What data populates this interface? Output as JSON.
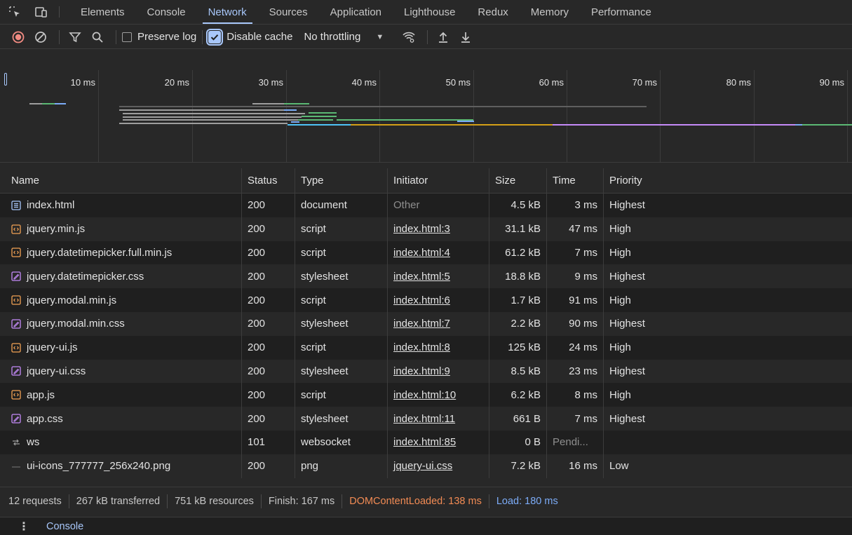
{
  "tabs": [
    {
      "label": "Elements"
    },
    {
      "label": "Console"
    },
    {
      "label": "Network"
    },
    {
      "label": "Sources"
    },
    {
      "label": "Application"
    },
    {
      "label": "Lighthouse"
    },
    {
      "label": "Redux"
    },
    {
      "label": "Memory"
    },
    {
      "label": "Performance"
    }
  ],
  "active_tab": "Network",
  "toolbar": {
    "preserve_log_label": "Preserve log",
    "disable_cache_label": "Disable cache",
    "throttling_value": "No throttling"
  },
  "overview": {
    "tick_labels": [
      "10 ms",
      "20 ms",
      "30 ms",
      "40 ms",
      "50 ms",
      "60 ms",
      "70 ms",
      "80 ms",
      "90 ms"
    ]
  },
  "table": {
    "headers": {
      "name": "Name",
      "status": "Status",
      "type": "Type",
      "initiator": "Initiator",
      "size": "Size",
      "time": "Time",
      "priority": "Priority"
    },
    "rows": [
      {
        "name": "index.html",
        "icon": "document-icon",
        "status": "200",
        "type": "document",
        "initiator": "Other",
        "initiator_link": false,
        "size": "4.5 kB",
        "time": "3 ms",
        "priority": "Highest"
      },
      {
        "name": "jquery.min.js",
        "icon": "script-icon",
        "status": "200",
        "type": "script",
        "initiator": "index.html:3",
        "initiator_link": true,
        "size": "31.1 kB",
        "time": "47 ms",
        "priority": "High"
      },
      {
        "name": "jquery.datetimepicker.full.min.js",
        "icon": "script-icon",
        "status": "200",
        "type": "script",
        "initiator": "index.html:4",
        "initiator_link": true,
        "size": "61.2 kB",
        "time": "7 ms",
        "priority": "High"
      },
      {
        "name": "jquery.datetimepicker.css",
        "icon": "stylesheet-icon",
        "status": "200",
        "type": "stylesheet",
        "initiator": "index.html:5",
        "initiator_link": true,
        "size": "18.8 kB",
        "time": "9 ms",
        "priority": "Highest"
      },
      {
        "name": "jquery.modal.min.js",
        "icon": "script-icon",
        "status": "200",
        "type": "script",
        "initiator": "index.html:6",
        "initiator_link": true,
        "size": "1.7 kB",
        "time": "91 ms",
        "priority": "High"
      },
      {
        "name": "jquery.modal.min.css",
        "icon": "stylesheet-icon",
        "status": "200",
        "type": "stylesheet",
        "initiator": "index.html:7",
        "initiator_link": true,
        "size": "2.2 kB",
        "time": "90 ms",
        "priority": "Highest"
      },
      {
        "name": "jquery-ui.js",
        "icon": "script-icon",
        "status": "200",
        "type": "script",
        "initiator": "index.html:8",
        "initiator_link": true,
        "size": "125 kB",
        "time": "24 ms",
        "priority": "High"
      },
      {
        "name": "jquery-ui.css",
        "icon": "stylesheet-icon",
        "status": "200",
        "type": "stylesheet",
        "initiator": "index.html:9",
        "initiator_link": true,
        "size": "8.5 kB",
        "time": "23 ms",
        "priority": "Highest"
      },
      {
        "name": "app.js",
        "icon": "script-icon",
        "status": "200",
        "type": "script",
        "initiator": "index.html:10",
        "initiator_link": true,
        "size": "6.2 kB",
        "time": "8 ms",
        "priority": "High"
      },
      {
        "name": "app.css",
        "icon": "stylesheet-icon",
        "status": "200",
        "type": "stylesheet",
        "initiator": "index.html:11",
        "initiator_link": true,
        "size": "661 B",
        "time": "7 ms",
        "priority": "Highest"
      },
      {
        "name": "ws",
        "icon": "websocket-icon",
        "status": "101",
        "type": "websocket",
        "initiator": "index.html:85",
        "initiator_link": true,
        "size": "0 B",
        "time": "Pendi...",
        "time_dim": true,
        "priority": ""
      },
      {
        "name": "ui-icons_777777_256x240.png",
        "icon": "image-icon",
        "status": "200",
        "type": "png",
        "initiator": "jquery-ui.css",
        "initiator_link": true,
        "size": "7.2 kB",
        "time": "16 ms",
        "priority": "Low"
      }
    ]
  },
  "statusbar": {
    "requests": "12 requests",
    "transferred": "267 kB transferred",
    "resources": "751 kB resources",
    "finish": "Finish: 167 ms",
    "dom_content_loaded": "DOMContentLoaded: 138 ms",
    "load": "Load: 180 ms"
  },
  "drawer": {
    "tab": "Console"
  },
  "colors": {
    "accent": "#a8c7fa",
    "dcl": "#f28b54",
    "load": "#7cacf8",
    "script": "#f2a254",
    "stylesheet": "#c58af9"
  }
}
